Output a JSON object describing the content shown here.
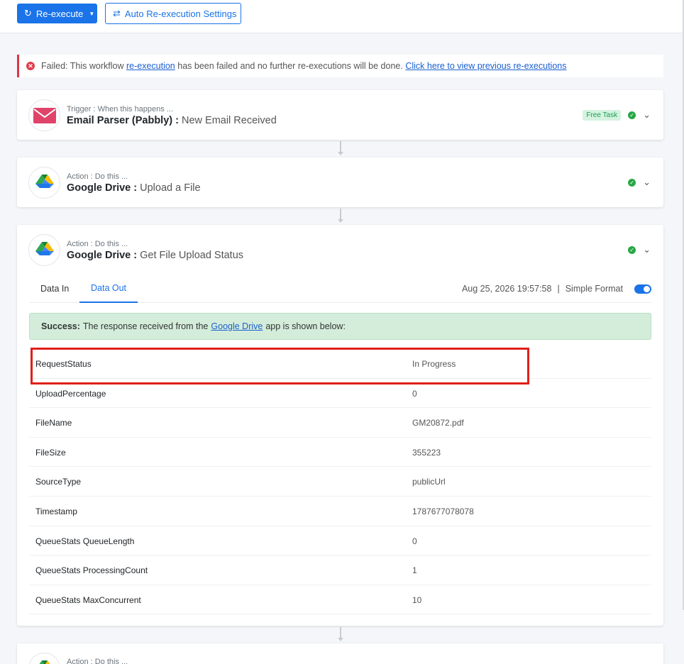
{
  "toolbar": {
    "reexecute_label": "Re-execute",
    "auto_settings_label": "Auto Re-execution Settings"
  },
  "alert": {
    "prefix": "Failed: This workflow",
    "link1": "re-execution",
    "middle": "has been failed and no further re-executions will be done.",
    "link2": "Click here to view previous re-executions"
  },
  "steps": [
    {
      "sub": "Trigger : When this happens ...",
      "app": "Email Parser (Pabbly) :",
      "event": "New Email Received",
      "badge": "Free Task"
    },
    {
      "sub": "Action : Do this ...",
      "app": "Google Drive :",
      "event": "Upload a File"
    },
    {
      "sub": "Action : Do this ...",
      "app": "Google Drive :",
      "event": "Get File Upload Status"
    },
    {
      "sub": "Action : Do this ..."
    }
  ],
  "detail": {
    "tab_in": "Data In",
    "tab_out": "Data Out",
    "timestamp": "Aug 25, 2026 19:57:58",
    "separator": "|",
    "format_label": "Simple Format",
    "simple_format_on": true,
    "success_bold": "Success:",
    "success_text_pre": "The response received from the",
    "success_link": "Google Drive",
    "success_text_post": "app is shown below:"
  },
  "response_rows": [
    {
      "key": "RequestStatus",
      "value": "In Progress"
    },
    {
      "key": "UploadPercentage",
      "value": "0"
    },
    {
      "key": "FileName",
      "value": "GM20872.pdf"
    },
    {
      "key": "FileSize",
      "value": "355223"
    },
    {
      "key": "SourceType",
      "value": "publicUrl"
    },
    {
      "key": "Timestamp",
      "value": "1787677078078"
    },
    {
      "key": "QueueStats QueueLength",
      "value": "0"
    },
    {
      "key": "QueueStats ProcessingCount",
      "value": "1"
    },
    {
      "key": "QueueStats MaxConcurrent",
      "value": "10"
    }
  ],
  "colors": {
    "primary": "#1a73e8",
    "error": "#dc3545",
    "success_bg": "#d4edda",
    "highlight": "#e0201a"
  }
}
